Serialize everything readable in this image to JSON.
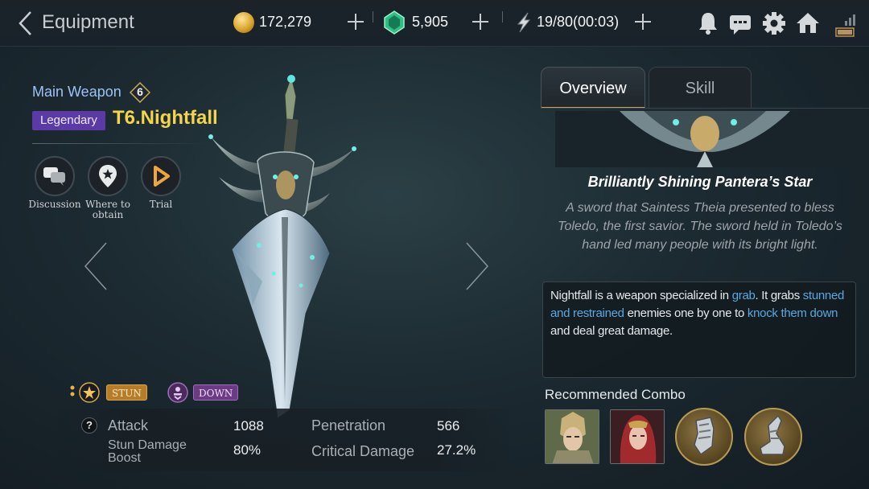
{
  "header": {
    "title": "Equipment",
    "gold": "172,279",
    "gems": "5,905",
    "stamina": "19/80(00:03)"
  },
  "weapon": {
    "type_label": "Main Weapon",
    "tier": "6",
    "grade": "Legendary",
    "name": "T6.Nightfall"
  },
  "actions": [
    {
      "label": "Discussion",
      "icon": "chat-bubbles-icon"
    },
    {
      "label": "Where to obtain",
      "icon": "map-pin-icon"
    },
    {
      "label": "Trial",
      "icon": "play-icon"
    }
  ],
  "tags": [
    {
      "label": "STUN",
      "icon": "star-burst-icon",
      "color": "#b77c2a"
    },
    {
      "label": "DOWN",
      "icon": "knockdown-icon",
      "color": "#6b3b84"
    }
  ],
  "stats": [
    {
      "label": "Attack",
      "value": "1088"
    },
    {
      "label": "Penetration",
      "value": "566"
    },
    {
      "label": "Stun Damage Boost",
      "value": "80%"
    },
    {
      "label": "Critical Damage",
      "value": "27.2%"
    }
  ],
  "tabs": [
    {
      "label": "Overview",
      "active": true
    },
    {
      "label": "Skill",
      "active": false
    }
  ],
  "details": {
    "item_title": "Brilliantly Shining Pantera’s Star",
    "lore": "A sword that Saintess Theia presented to bless Toledo, the first savior. The sword held in Toledo’s hand led many people with its bright light.",
    "desc_1": "Nightfall is a weapon specialized in ",
    "desc_kw_1": "grab",
    "desc_2": ". It grabs ",
    "desc_kw_2": "stunned and restrained",
    "desc_3": " enemies one by one to ",
    "desc_kw_3": "knock them down",
    "desc_4": " and deal great damage."
  },
  "combo": {
    "title": "Recommended Combo",
    "slots": [
      "armored-knight-portrait",
      "red-haired-warrior-portrait",
      "gauntlet-icon",
      "boot-icon"
    ]
  },
  "colors": {
    "accent_gold": "#f4d54a",
    "legendary_purple": "#5b3aa6",
    "keyword_blue": "#5aa8e0",
    "weapon_type_blue": "#9dc3f5"
  }
}
